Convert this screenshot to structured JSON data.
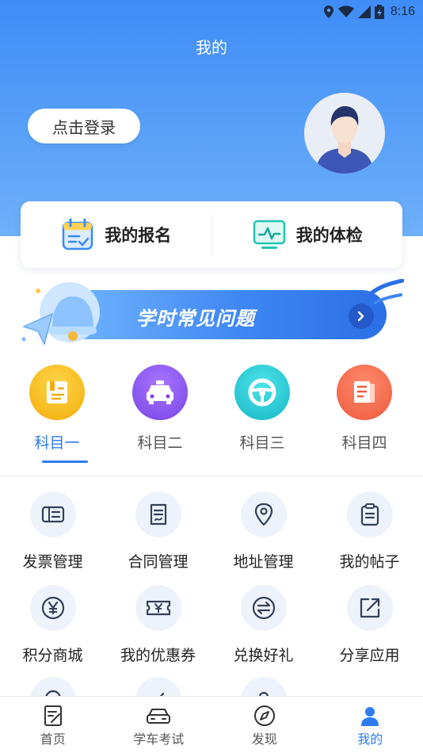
{
  "status_bar": {
    "time": "8:16"
  },
  "header": {
    "title": "我的"
  },
  "profile": {
    "login_label": "点击登录"
  },
  "quick_card": {
    "registration": "我的报名",
    "physical_exam": "我的体检"
  },
  "banner": {
    "text": "学时常见问题"
  },
  "subjects": [
    {
      "label": "科目一",
      "color": "#f8b400"
    },
    {
      "label": "科目二",
      "color": "#8a55ef"
    },
    {
      "label": "科目三",
      "color": "#21c3cf"
    },
    {
      "label": "科目四",
      "color": "#f2644a"
    }
  ],
  "services": [
    {
      "label": "发票管理",
      "icon": "invoice-icon"
    },
    {
      "label": "合同管理",
      "icon": "contract-icon"
    },
    {
      "label": "地址管理",
      "icon": "location-icon"
    },
    {
      "label": "我的帖子",
      "icon": "clipboard-icon"
    },
    {
      "label": "积分商城",
      "icon": "yen-coin-icon"
    },
    {
      "label": "我的优惠券",
      "icon": "coupon-icon"
    },
    {
      "label": "兑换好礼",
      "icon": "exchange-icon"
    },
    {
      "label": "分享应用",
      "icon": "share-icon"
    }
  ],
  "tabs": [
    {
      "label": "首页"
    },
    {
      "label": "学车考试"
    },
    {
      "label": "发现"
    },
    {
      "label": "我的"
    }
  ],
  "colors": {
    "accent": "#2d7cf0",
    "hero": "#4a93f7",
    "icon_stroke": "#33405a"
  }
}
